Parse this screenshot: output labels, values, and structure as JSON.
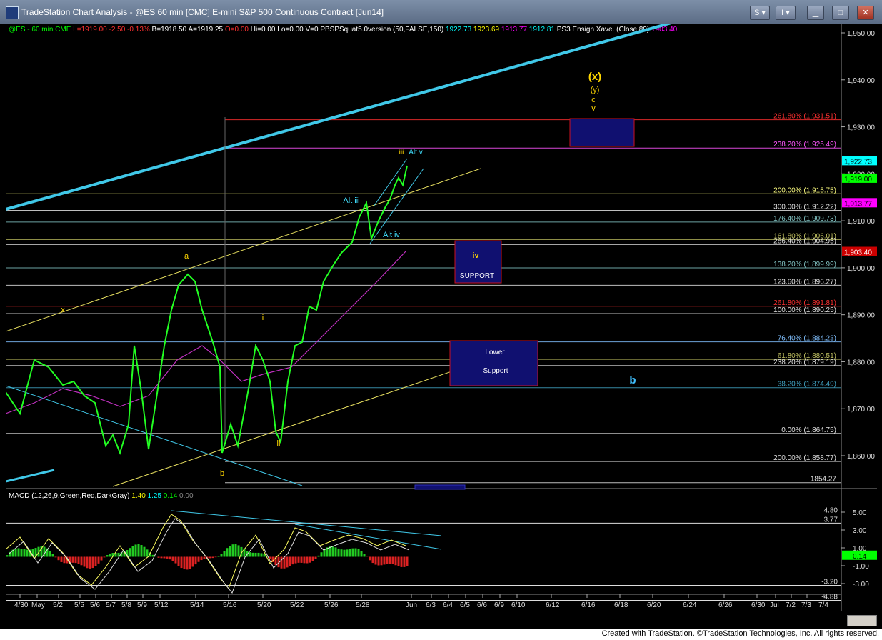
{
  "window": {
    "title": "TradeStation Chart Analysis - @ES 60 min [CMC] E-mini S&P 500 Continuous Contract [Jun14]",
    "buttons": [
      "S",
      "I"
    ]
  },
  "header": {
    "symbol_line": [
      {
        "text": "@ES - 60 min  CME",
        "color": "#00ff00"
      },
      {
        "text": "L=1919.00  -2.50  -0.13%",
        "color": "#ff3030"
      },
      {
        "text": "B=1918.50  A=1919.25",
        "color": "#ffffff"
      },
      {
        "text": "O=0.00",
        "color": "#ff3030"
      },
      {
        "text": "Hi=0.00  Lo=0.00  V=0",
        "color": "#ffffff"
      },
      {
        "text": "PBSPSquat5.0version (50,FALSE,150)",
        "color": "#ffffff"
      },
      {
        "text": "1922.73",
        "color": "#00ffff"
      },
      {
        "text": "1923.69",
        "color": "#ffff00"
      },
      {
        "text": "1913.77",
        "color": "#ff00ff"
      },
      {
        "text": "1912.81",
        "color": "#00ffff"
      },
      {
        "text": "PS3 Ensign Xave. (Close,89)",
        "color": "#ffffff"
      },
      {
        "text": "1903.40",
        "color": "#ff00ff"
      }
    ],
    "macd_line": [
      {
        "text": "MACD (12,26,9,Green,Red,DarkGray)",
        "color": "#ffffff"
      },
      {
        "text": "1.40",
        "color": "#ffff00"
      },
      {
        "text": "1.25",
        "color": "#00ffff"
      },
      {
        "text": "0.14",
        "color": "#00ff00"
      },
      {
        "text": "0.00",
        "color": "#888888"
      }
    ]
  },
  "price_axis": {
    "ticks": [
      "1,950.00",
      "1,940.00",
      "1,930.00",
      "1,920.00",
      "1,910.00",
      "1,900.00",
      "1,890.00",
      "1,880.00",
      "1,870.00",
      "1,860.00"
    ],
    "tick_values": [
      1950,
      1940,
      1930,
      1920,
      1910,
      1900,
      1890,
      1880,
      1870,
      1860
    ],
    "markers": [
      {
        "text": "1,922.73",
        "value": 1922.73,
        "bg": "#00ffff",
        "fg": "#000000"
      },
      {
        "text": "1,919.00",
        "value": 1919.0,
        "bg": "#00ff00",
        "fg": "#000000"
      },
      {
        "text": "1,913.77",
        "value": 1913.77,
        "bg": "#ff00ff",
        "fg": "#000000"
      },
      {
        "text": "1,903.40",
        "value": 1903.4,
        "bg": "#cc0000",
        "fg": "#ffffff"
      }
    ]
  },
  "macd_axis": {
    "ticks": [
      "5.00",
      "3.00",
      "1.00",
      "-1.00",
      "-3.00"
    ],
    "tick_values": [
      5,
      3,
      1,
      -1,
      -3
    ],
    "labels": [
      {
        "text": "4.80",
        "value": 4.8
      },
      {
        "text": "3.77",
        "value": 3.77
      },
      {
        "text": "-3.20",
        "value": -3.2
      },
      {
        "text": "-4.88",
        "value": -4.88
      }
    ],
    "marker": {
      "text": "0.14",
      "value": 0.14
    }
  },
  "fib_levels": [
    {
      "text": "261.80% (1,931.51)",
      "value": 1931.51,
      "color": "#ff3030"
    },
    {
      "text": "238.20% (1,925.49)",
      "value": 1925.49,
      "color": "#ff55ff"
    },
    {
      "text": "200.00% (1,915.75)",
      "value": 1915.75,
      "color": "#ffff80"
    },
    {
      "text": "300.00% (1,912.22)",
      "value": 1912.22,
      "color": "#e0e0e0"
    },
    {
      "text": "176.40% (1,909.73)",
      "value": 1909.73,
      "color": "#80c0c0"
    },
    {
      "text": "161.80% (1,906.01)",
      "value": 1906.01,
      "color": "#c0c060"
    },
    {
      "text": "286.40% (1,904.95)",
      "value": 1904.95,
      "color": "#e0e0e0"
    },
    {
      "text": "138.20% (1,899.99)",
      "value": 1899.99,
      "color": "#80c0c0"
    },
    {
      "text": "123.60% (1,896.27)",
      "value": 1896.27,
      "color": "#e0e0e0"
    },
    {
      "text": "261.80% (1,891.81)",
      "value": 1891.81,
      "color": "#ff3030"
    },
    {
      "text": "100.00% (1,890.25)",
      "value": 1890.25,
      "color": "#e0e0e0"
    },
    {
      "text": "76.40% (1,884.23)",
      "value": 1884.23,
      "color": "#80c0ff"
    },
    {
      "text": "61.80% (1,880.51)",
      "value": 1880.51,
      "color": "#c0c060"
    },
    {
      "text": "238.20% (1,879.19)",
      "value": 1879.19,
      "color": "#e0e0e0"
    },
    {
      "text": "38.20% (1,874.49)",
      "value": 1874.49,
      "color": "#40a0c0"
    },
    {
      "text": "0.00% (1,864.75)",
      "value": 1864.75,
      "color": "#e0e0e0"
    },
    {
      "text": "200.00% (1,858.77)",
      "value": 1858.77,
      "color": "#e0e0e0"
    },
    {
      "text": "1854.27",
      "value": 1854.27,
      "color": "#e0e0e0"
    }
  ],
  "wave_labels": [
    {
      "text": "(x)",
      "color": "#ffd700"
    },
    {
      "text": "(y)",
      "color": "#ffd700"
    },
    {
      "text": "c",
      "color": "#ffd700"
    },
    {
      "text": "v",
      "color": "#ffd700"
    },
    {
      "text": "iii",
      "color": "#ffd700"
    },
    {
      "text": "Alt v",
      "color": "#40e0ff"
    },
    {
      "text": "Alt iii",
      "color": "#40e0ff"
    },
    {
      "text": "Alt iv",
      "color": "#40e0ff"
    },
    {
      "text": "a",
      "color": "#ffd700"
    },
    {
      "text": "x",
      "color": "#ffd700"
    },
    {
      "text": "i",
      "color": "#ffd700"
    },
    {
      "text": "ii",
      "color": "#ffd700"
    },
    {
      "text": "b",
      "color": "#ffd700"
    },
    {
      "text": "b",
      "color": "#40c0ff"
    }
  ],
  "boxes": [
    {
      "lines": [
        "iv",
        "SUPPORT"
      ]
    },
    {
      "lines": [
        "Lower",
        "Support"
      ]
    }
  ],
  "time_axis": {
    "labels": [
      "4/30",
      "May",
      "5/2",
      "5/5",
      "5/6",
      "5/7",
      "5/8",
      "5/9",
      "5/12",
      "5/14",
      "5/16",
      "5/20",
      "5/22",
      "5/26",
      "5/28",
      "Jun",
      "6/3",
      "6/4",
      "6/5",
      "6/6",
      "6/9",
      "6/10",
      "6/12",
      "6/16",
      "6/18",
      "6/20",
      "6/24",
      "6/26",
      "6/30",
      "Jul",
      "7/2",
      "7/3",
      "7/4"
    ]
  },
  "footer": {
    "text": "Created with TradeStation. ©TradeStation Technologies, Inc. All rights reserved."
  }
}
